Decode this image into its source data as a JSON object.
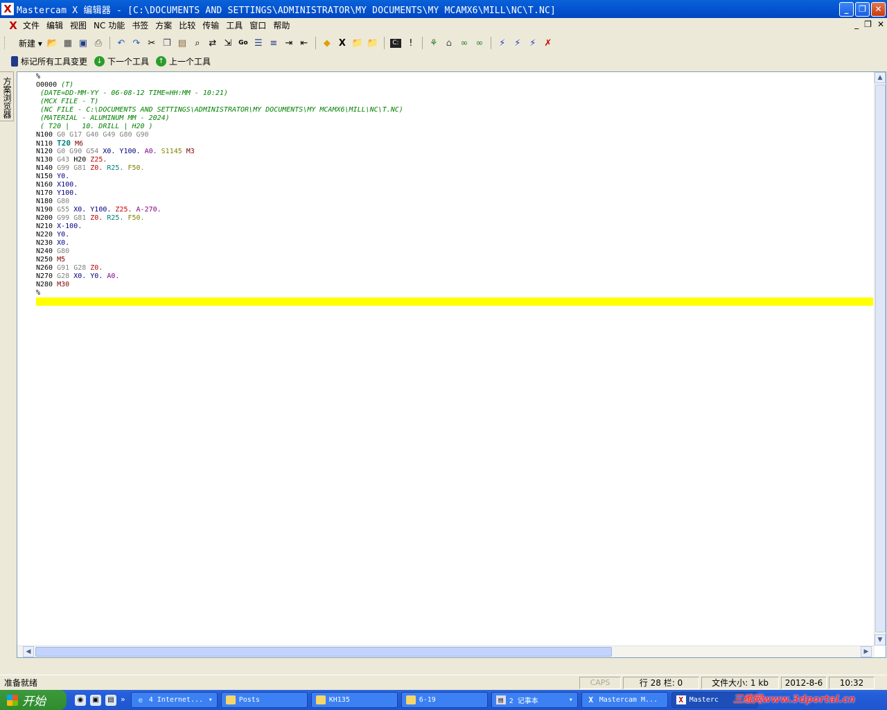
{
  "window": {
    "title": "Mastercam X 编辑器 - [C:\\DOCUMENTS AND SETTINGS\\ADMINISTRATOR\\MY DOCUMENTS\\MY MCAMX6\\MILL\\NC\\T.NC]",
    "app_icon": "X",
    "controls": [
      "_",
      "❐",
      "✕"
    ]
  },
  "menubar": {
    "doc_icon": "X",
    "items": [
      "文件",
      "编辑",
      "视图",
      "NC 功能",
      "书签",
      "方案",
      "比较",
      "传输",
      "工具",
      "窗口",
      "帮助"
    ],
    "mdi_controls": [
      "_",
      "❐",
      "✕"
    ]
  },
  "toolbar1": {
    "new_label": "新建",
    "icons": [
      "open-folder-icon",
      "table-icon",
      "save-icon",
      "print-icon",
      "undo-icon",
      "redo-icon",
      "cut-icon",
      "copy-icon",
      "paste-icon",
      "find-icon",
      "replace-icon",
      "goto-icon",
      "go-icon",
      "list-icon",
      "renumber-icon",
      "indent-icon",
      "outdent-icon",
      "bookmark-icon",
      "mastercam-icon",
      "open-file-icon",
      "open-file2-icon",
      "terminal-icon",
      "info-icon",
      "tool-path-icon",
      "machine-icon",
      "link1-icon",
      "link2-icon",
      "bolt1-icon",
      "bolt2-icon",
      "bolt3-icon",
      "bolt-delete-icon"
    ]
  },
  "toolbar2": {
    "mark_all": "标记所有工具变更",
    "next_tool": "下一个工具",
    "prev_tool": "上一个工具"
  },
  "side_panel": {
    "tab_label": "方案浏览器"
  },
  "editor": {
    "lines": [
      [
        [
          "%",
          "def"
        ]
      ],
      [
        [
          "O0000 ",
          "def"
        ],
        [
          "(T)",
          "comment"
        ]
      ],
      [
        [
          " (DATE=DD-MM-YY - 06-08-12 TIME=HH:MM - 10:21)",
          "comment"
        ]
      ],
      [
        [
          " (MCX FILE - T)",
          "comment"
        ]
      ],
      [
        [
          " (NC FILE - C:\\DOCUMENTS AND SETTINGS\\ADMINISTRATOR\\MY DOCUMENTS\\MY MCAMX6\\MILL\\NC\\T.NC)",
          "comment"
        ]
      ],
      [
        [
          " (MATERIAL - ALUMINUM MM - 2024)",
          "comment"
        ]
      ],
      [
        [
          " ( T20 |   10. DRILL | H20 )",
          "comment"
        ]
      ],
      [
        [
          "N100 ",
          "def"
        ],
        [
          "G0 G17 G40 G49 G80 G90",
          "g"
        ]
      ],
      [
        [
          "N110 ",
          "def"
        ],
        [
          "T20",
          "t"
        ],
        [
          " ",
          "def"
        ],
        [
          "M6",
          "m"
        ]
      ],
      [
        [
          "N120 ",
          "def"
        ],
        [
          "G0 G90 G54 ",
          "g"
        ],
        [
          "X0. Y100. ",
          "x"
        ],
        [
          "A0. ",
          "a"
        ],
        [
          "S1145 ",
          "s"
        ],
        [
          "M3",
          "m"
        ]
      ],
      [
        [
          "N130 ",
          "def"
        ],
        [
          "G43 ",
          "g"
        ],
        [
          "H20 ",
          "def"
        ],
        [
          "Z25.",
          "z"
        ]
      ],
      [
        [
          "N140 ",
          "def"
        ],
        [
          "G99 G81 ",
          "g"
        ],
        [
          "Z0. ",
          "z"
        ],
        [
          "R25. ",
          "r"
        ],
        [
          "F50.",
          "f"
        ]
      ],
      [
        [
          "N150 ",
          "def"
        ],
        [
          "Y0.",
          "x"
        ]
      ],
      [
        [
          "N160 ",
          "def"
        ],
        [
          "X100.",
          "x"
        ]
      ],
      [
        [
          "N170 ",
          "def"
        ],
        [
          "Y100.",
          "x"
        ]
      ],
      [
        [
          "N180 ",
          "def"
        ],
        [
          "G80",
          "g"
        ]
      ],
      [
        [
          "N190 ",
          "def"
        ],
        [
          "G55 ",
          "g"
        ],
        [
          "X0. Y100. ",
          "x"
        ],
        [
          "Z25. ",
          "z"
        ],
        [
          "A-270.",
          "a"
        ]
      ],
      [
        [
          "N200 ",
          "def"
        ],
        [
          "G99 G81 ",
          "g"
        ],
        [
          "Z0. ",
          "z"
        ],
        [
          "R25. ",
          "r"
        ],
        [
          "F50.",
          "f"
        ]
      ],
      [
        [
          "N210 ",
          "def"
        ],
        [
          "X-100.",
          "x"
        ]
      ],
      [
        [
          "N220 ",
          "def"
        ],
        [
          "Y0.",
          "x"
        ]
      ],
      [
        [
          "N230 ",
          "def"
        ],
        [
          "X0.",
          "x"
        ]
      ],
      [
        [
          "N240 ",
          "def"
        ],
        [
          "G80",
          "g"
        ]
      ],
      [
        [
          "N250 ",
          "def"
        ],
        [
          "M5",
          "m"
        ]
      ],
      [
        [
          "N260 ",
          "def"
        ],
        [
          "G91 G28 ",
          "g"
        ],
        [
          "Z0.",
          "z"
        ]
      ],
      [
        [
          "N270 ",
          "def"
        ],
        [
          "G28 ",
          "g"
        ],
        [
          "X0. Y0. ",
          "x"
        ],
        [
          "A0.",
          "a"
        ]
      ],
      [
        [
          "N280 ",
          "def"
        ],
        [
          "M30",
          "m"
        ]
      ],
      [
        [
          "%",
          "def"
        ]
      ]
    ],
    "current_line_highlight": "#ffff00"
  },
  "statusbar": {
    "ready": "准备就绪",
    "caps": "CAPS",
    "row_col": "行 28  栏: 0",
    "file_size": "文件大小: 1 kb",
    "date": "2012-8-6",
    "time": "10:32"
  },
  "taskbar": {
    "start": "开始",
    "overflow": "»",
    "tasks": [
      {
        "label": "4 Internet...",
        "icon": "ie-icon"
      },
      {
        "label": "Posts",
        "icon": "folder-icon"
      },
      {
        "label": "KH135",
        "icon": "folder-icon"
      },
      {
        "label": "6-19",
        "icon": "folder-icon"
      },
      {
        "label": "2 记事本",
        "icon": "notepad-icon"
      },
      {
        "label": "Mastercam M...",
        "icon": "mastercam-icon"
      },
      {
        "label": "Masterc",
        "icon": "mastercam-icon"
      }
    ],
    "watermark": "三维网www.3dportal.cn"
  }
}
